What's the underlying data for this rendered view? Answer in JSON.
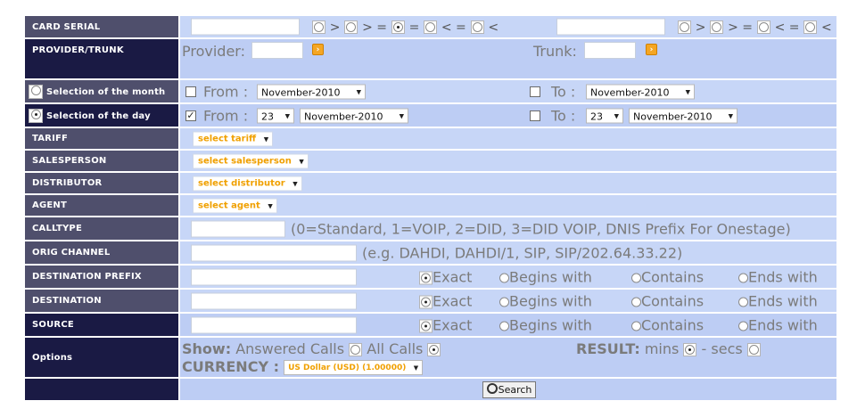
{
  "labels": {
    "card_serial": "CARD SERIAL",
    "provider_trunk": "PROVIDER/TRUNK",
    "month": "Selection of the month",
    "day": "Selection of the day",
    "tariff": "TARIFF",
    "salesperson": "SALESPERSON",
    "distributor": "DISTRIBUTOR",
    "agent": "AGENT",
    "calltype": "CALLTYPE",
    "orig_channel": "ORIG CHANNEL",
    "dest_prefix": "DESTINATION PREFIX",
    "destination": "DESTINATION",
    "source": "SOURCE",
    "options": "Options"
  },
  "ops": {
    "gt": ">",
    "ge": "> =",
    "le": "< =",
    "lt": "<"
  },
  "provider": {
    "label": "Provider:",
    "trunk_label": "Trunk:"
  },
  "month": {
    "from": "From :",
    "to": "To :",
    "from_value": "November-2010",
    "to_value": "November-2010"
  },
  "day": {
    "from": "From :",
    "to": "To :",
    "from_day": "23",
    "from_month": "November-2010",
    "to_day": "23",
    "to_month": "November-2010"
  },
  "tariff": {
    "value": "select tariff"
  },
  "salesperson": {
    "value": "select salesperson"
  },
  "distributor": {
    "value": "select distributor"
  },
  "agent": {
    "value": "select agent"
  },
  "calltype": {
    "hint": "(0=Standard, 1=VOIP, 2=DID, 3=DID VOIP, DNIS Prefix For Onestage)"
  },
  "orig_channel": {
    "hint": "(e.g. DAHDI, DAHDI/1, SIP, SIP/202.64.33.22)"
  },
  "match": {
    "exact": "Exact",
    "begins": "Begins with",
    "contains": "Contains",
    "ends": "Ends with"
  },
  "options": {
    "show_label": "Show:",
    "answered": "Answered Calls",
    "all": "All Calls",
    "result_label": "RESULT:",
    "mins": "mins",
    "secs": "- secs",
    "currency_label": "CURRENCY :",
    "currency_value": "US Dollar (USD) (1.00000)"
  },
  "search": {
    "label": "Search"
  },
  "colors": {
    "label_bg": "#4f4f6c",
    "label_dark": "#1a1a44",
    "value_bg": "#c7d6f7",
    "accent": "#f0a000"
  }
}
